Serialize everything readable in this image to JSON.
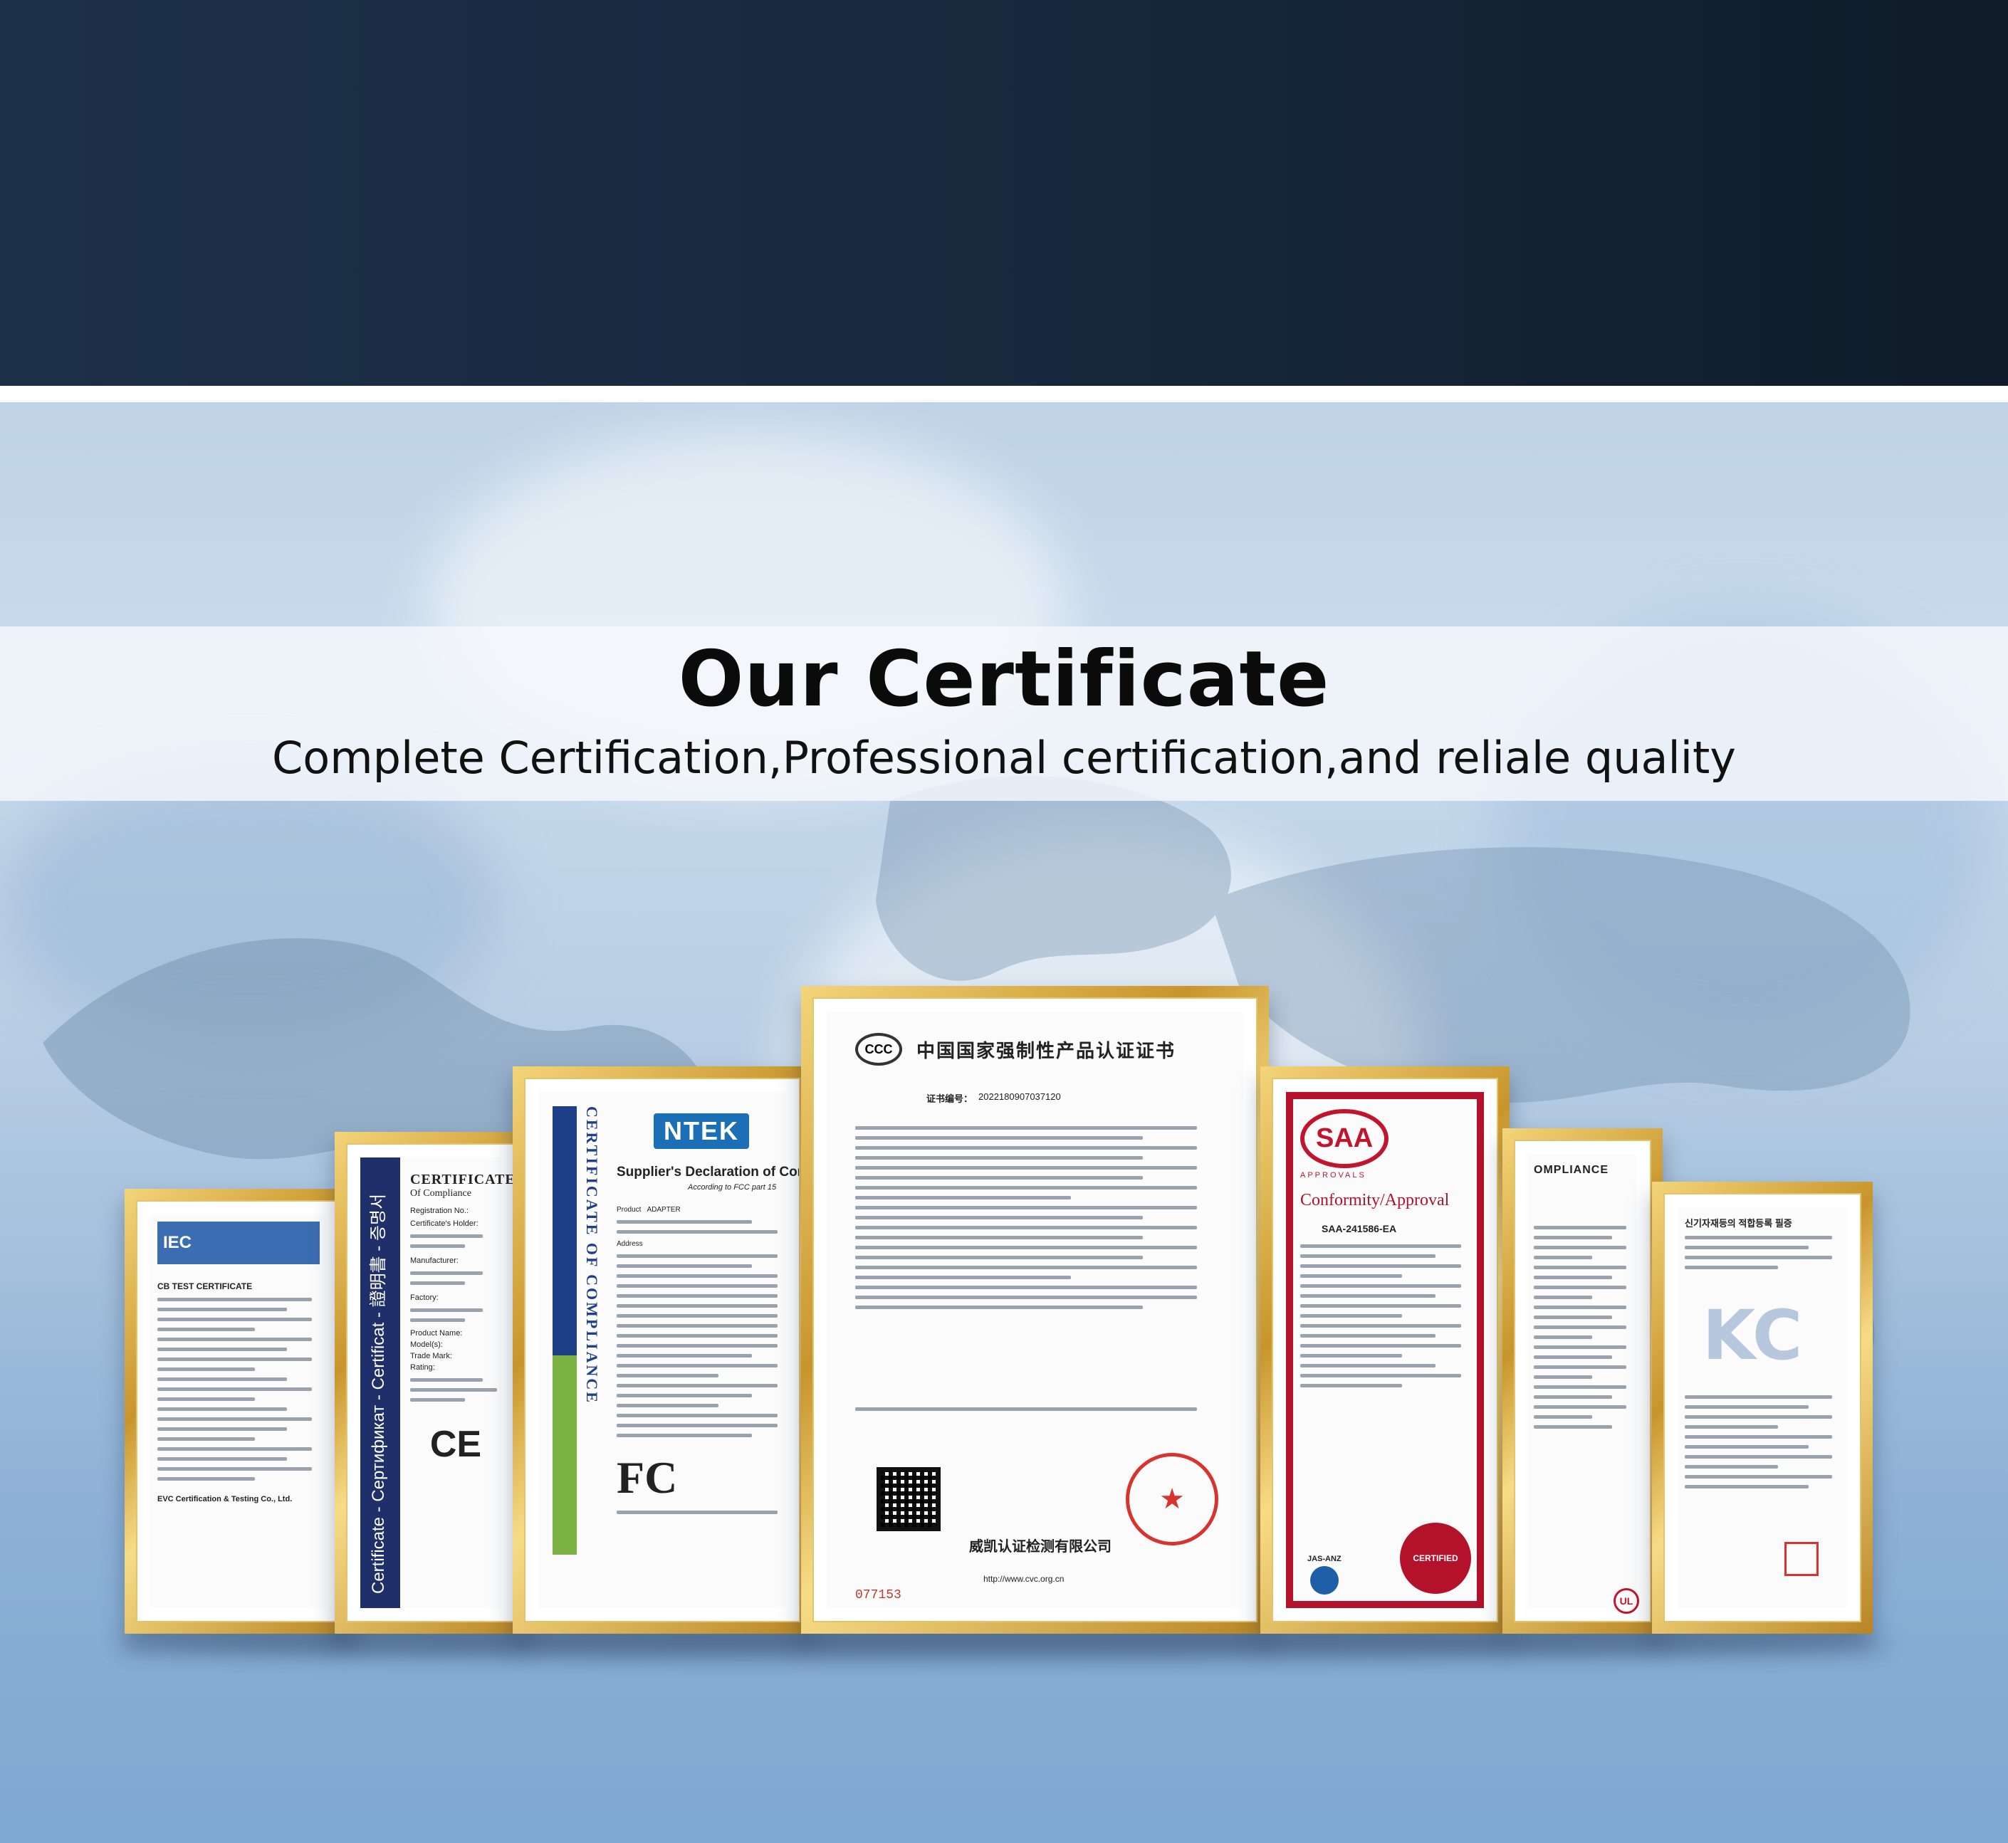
{
  "header": {
    "title": "Our Certificate",
    "subtitle": "Complete Certification,Professional certification,and reliale quality"
  },
  "colors": {
    "top_band": "#17283d",
    "frame_gold": "#c8952c",
    "saa_red": "#c2142c",
    "ntek_blue": "#1b6fb5"
  },
  "certificates": {
    "ccc": {
      "heading": "中国国家强制性产品认证证书",
      "cert_no_label": "证书编号：",
      "cert_no": "2022180907037120",
      "issuer": "威凯认证检测有限公司",
      "website": "http://www.cvc.org.cn",
      "serial": "077153"
    },
    "ntek": {
      "logo": "NTEK",
      "heading": "Supplier's Declaration of Conf",
      "side_text": "CERTIFICATE OF COMPLIANCE",
      "subhead": "According to FCC part 15",
      "fcc_logo": "FC",
      "product_label": "Product",
      "product": "ADAPTER",
      "address_label": "Address"
    },
    "ce": {
      "heading": "CERTIFICATE",
      "subheading": "Of Compliance",
      "registration_label": "Registration No.:",
      "holder_label": "Certificate's Holder:",
      "manufacturer_label": "Manufacturer:",
      "factory_label": "Factory:",
      "product_name_label": "Product Name:",
      "model_label": "Model(s):",
      "trade_mark_label": "Trade Mark:",
      "rating_label": "Rating:",
      "ce_mark": "CE",
      "side_text": "Certificate - Сертификат - Certificat - 證明書 - 증명서"
    },
    "iec": {
      "heading": "CB TEST CERTIFICATE",
      "issuer": "EVC Certification & Testing Co., Ltd."
    },
    "saa": {
      "logo": "SAA",
      "approvals": "APPROVALS",
      "heading": "Conformity/Approval",
      "cert_no": "SAA-241586-EA",
      "accreditation": "JAS-ANZ",
      "seal": "CERTIFIED"
    },
    "ul": {
      "heading": "OMPLIANCE",
      "mark": "UL"
    },
    "kc": {
      "heading": "신기자재등의 적합등록 필증",
      "logo": "KC"
    }
  }
}
